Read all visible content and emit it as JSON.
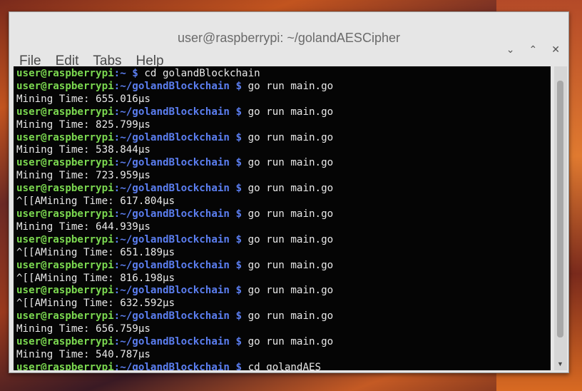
{
  "window": {
    "title": "user@raspberrypi: ~/golandAESCipher",
    "controls": [
      "⌄",
      "⌃",
      "✕"
    ]
  },
  "menu": [
    "File",
    "Edit",
    "Tabs",
    "Help"
  ],
  "terminal": {
    "lines": [
      {
        "u": "user@raspberrypi",
        "p": ":~ $",
        "t": " cd golandBlockchain"
      },
      {
        "u": "user@raspberrypi",
        "p": ":~/golandBlockchain $",
        "t": " go run main.go"
      },
      {
        "t": "Mining Time: 655.016µs"
      },
      {
        "u": "user@raspberrypi",
        "p": ":~/golandBlockchain $",
        "t": " go run main.go"
      },
      {
        "t": "Mining Time: 825.799µs"
      },
      {
        "u": "user@raspberrypi",
        "p": ":~/golandBlockchain $",
        "t": " go run main.go"
      },
      {
        "t": "Mining Time: 538.844µs"
      },
      {
        "u": "user@raspberrypi",
        "p": ":~/golandBlockchain $",
        "t": " go run main.go"
      },
      {
        "t": "Mining Time: 723.959µs"
      },
      {
        "u": "user@raspberrypi",
        "p": ":~/golandBlockchain $",
        "t": " go run main.go"
      },
      {
        "t": "^[[AMining Time: 617.804µs"
      },
      {
        "u": "user@raspberrypi",
        "p": ":~/golandBlockchain $",
        "t": " go run main.go"
      },
      {
        "t": "Mining Time: 644.939µs"
      },
      {
        "u": "user@raspberrypi",
        "p": ":~/golandBlockchain $",
        "t": " go run main.go"
      },
      {
        "t": "^[[AMining Time: 651.189µs"
      },
      {
        "u": "user@raspberrypi",
        "p": ":~/golandBlockchain $",
        "t": " go run main.go"
      },
      {
        "t": "^[[AMining Time: 816.198µs"
      },
      {
        "u": "user@raspberrypi",
        "p": ":~/golandBlockchain $",
        "t": " go run main.go"
      },
      {
        "t": "^[[AMining Time: 632.592µs"
      },
      {
        "u": "user@raspberrypi",
        "p": ":~/golandBlockchain $",
        "t": " go run main.go"
      },
      {
        "t": "Mining Time: 656.759µs"
      },
      {
        "u": "user@raspberrypi",
        "p": ":~/golandBlockchain $",
        "t": " go run main.go"
      },
      {
        "t": "Mining Time: 540.787µs"
      },
      {
        "u": "user@raspberrypi",
        "p": ":~/golandBlockchain $",
        "t": " cd golandAES"
      }
    ]
  },
  "colors": {
    "user": "#7bd850",
    "path": "#5b7ef0",
    "output": "#e8e8e8",
    "background": "#050505"
  }
}
